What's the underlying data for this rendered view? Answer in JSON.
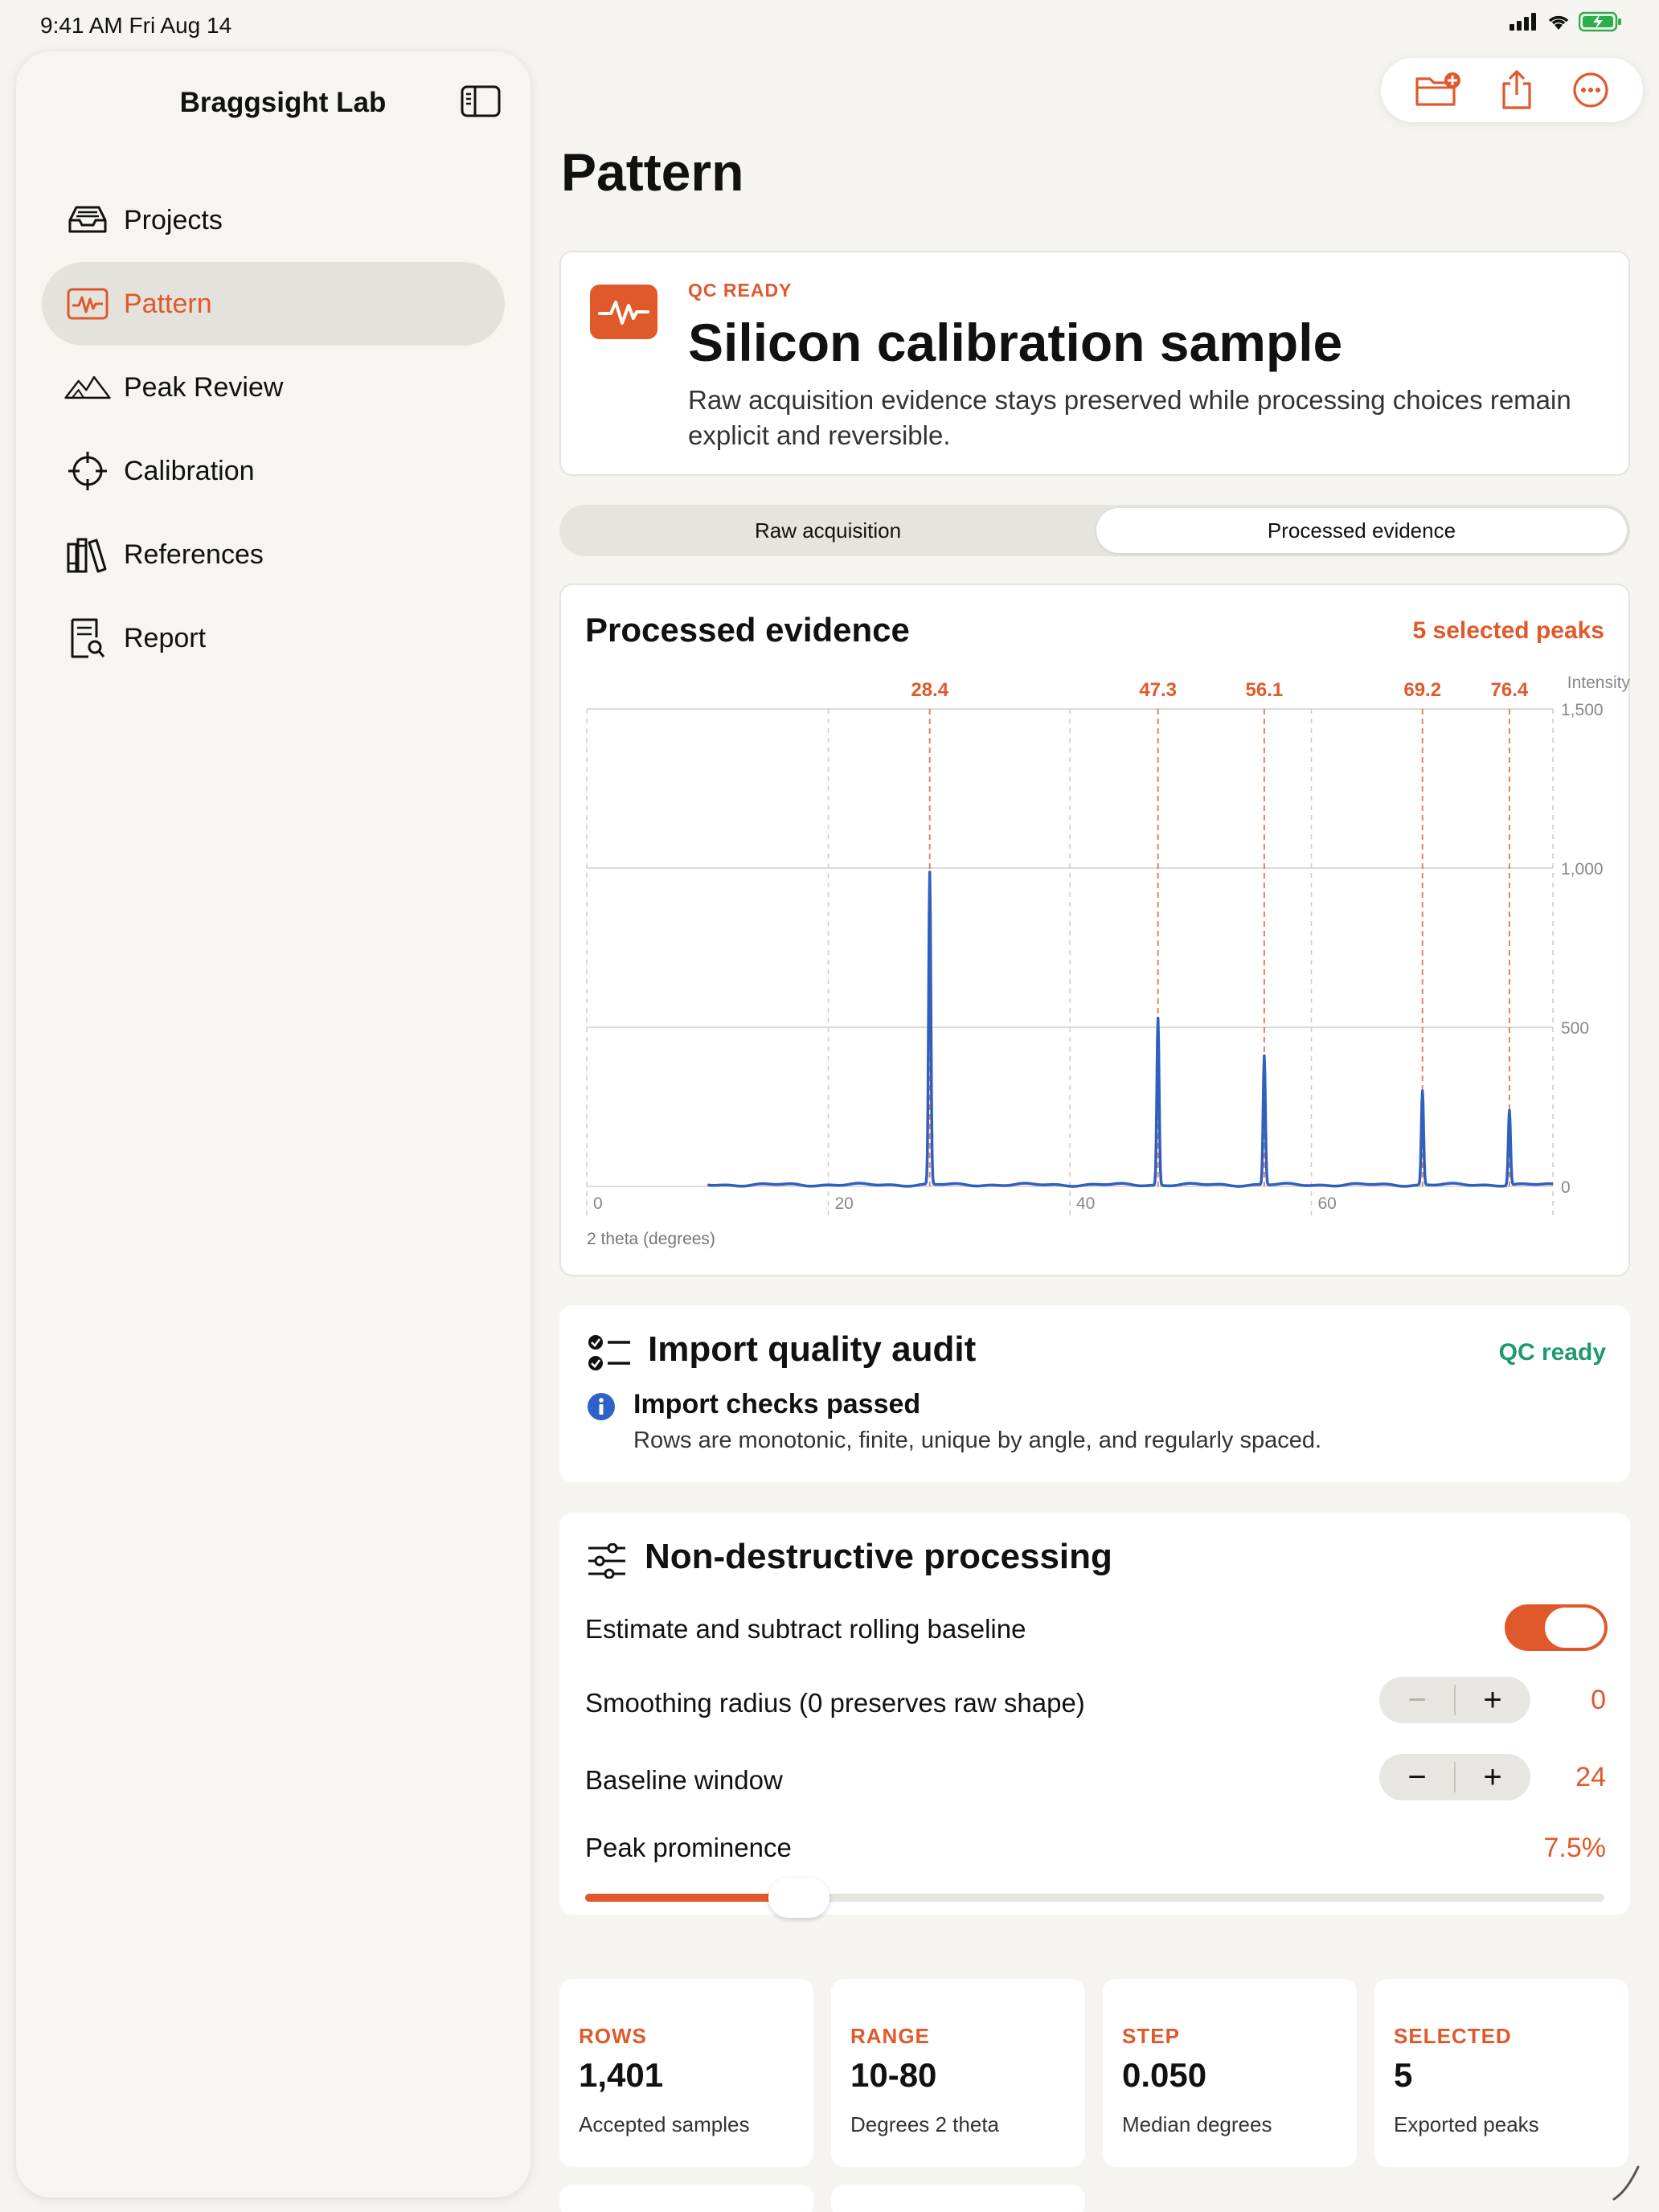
{
  "status": {
    "time": "9:41 AM   Fri Aug 14"
  },
  "sidebar": {
    "title": "Braggsight Lab",
    "items": [
      {
        "label": "Projects",
        "icon": "tray-icon"
      },
      {
        "label": "Pattern",
        "icon": "waveform-icon",
        "active": true
      },
      {
        "label": "Peak Review",
        "icon": "mountains-icon"
      },
      {
        "label": "Calibration",
        "icon": "crosshair-icon"
      },
      {
        "label": "References",
        "icon": "books-icon"
      },
      {
        "label": "Report",
        "icon": "report-search-icon"
      }
    ]
  },
  "toolbar": {
    "icons": [
      "folder-add-icon",
      "share-icon",
      "more-icon"
    ]
  },
  "page": {
    "title": "Pattern"
  },
  "hero": {
    "eyebrow": "QC READY",
    "title": "Silicon calibration sample",
    "description": "Raw acquisition evidence stays preserved while processing choices remain explicit and reversible."
  },
  "segmented": {
    "options": [
      "Raw acquisition",
      "Processed evidence"
    ],
    "selected": "Processed evidence"
  },
  "chart": {
    "title": "Processed evidence",
    "badge": "5 selected peaks"
  },
  "chart_data": {
    "type": "line",
    "xlabel": "2 theta (degrees)",
    "ylabel": "Intensity",
    "xlim": [
      0,
      80
    ],
    "ylim": [
      0,
      1500
    ],
    "x_ticks": [
      0,
      20,
      40,
      60
    ],
    "x_tick_labels": [
      "0",
      "20",
      "40",
      "60"
    ],
    "y_ticks": [
      0,
      500,
      1000,
      1500
    ],
    "y_tick_labels": [
      "0",
      "500",
      "1,000",
      "1,500"
    ],
    "grid": true,
    "y_axis_side": "right",
    "series": [
      {
        "color": "#2f5fbf",
        "baseline": 5,
        "x_start": 10,
        "x_end": 80,
        "peaks": [
          {
            "x": 28.4,
            "y": 980
          },
          {
            "x": 47.3,
            "y": 525
          },
          {
            "x": 56.1,
            "y": 405
          },
          {
            "x": 69.2,
            "y": 295
          },
          {
            "x": 76.4,
            "y": 235
          }
        ]
      }
    ],
    "markers": [
      {
        "x": 28.4,
        "label": "28.4"
      },
      {
        "x": 47.3,
        "label": "47.3"
      },
      {
        "x": 56.1,
        "label": "56.1"
      },
      {
        "x": 69.2,
        "label": "69.2"
      },
      {
        "x": 76.4,
        "label": "76.4"
      }
    ],
    "marker_color": "#e0592a"
  },
  "audit": {
    "title": "Import quality audit",
    "status": "QC ready",
    "check_title": "Import checks passed",
    "check_desc": "Rows are monotonic, finite, unique by angle, and regularly spaced."
  },
  "processing": {
    "title": "Non-destructive processing",
    "baseline_toggle_label": "Estimate and subtract rolling baseline",
    "baseline_toggle_on": true,
    "smoothing_label": "Smoothing radius (0 preserves raw shape)",
    "smoothing_value": "0",
    "window_label": "Baseline window",
    "window_value": "24",
    "prominence_label": "Peak prominence",
    "prominence_value": "7.5%",
    "prominence_fraction": 0.21
  },
  "stats": [
    {
      "label": "ROWS",
      "value": "1,401",
      "sub": "Accepted samples"
    },
    {
      "label": "RANGE",
      "value": "10-80",
      "sub": "Degrees 2 theta"
    },
    {
      "label": "STEP",
      "value": "0.050",
      "sub": "Median degrees"
    },
    {
      "label": "SELECTED",
      "value": "5",
      "sub": "Exported peaks"
    }
  ],
  "colors": {
    "accent": "#e0592a",
    "success": "#1f9a6b",
    "series": "#2f5fbf"
  }
}
